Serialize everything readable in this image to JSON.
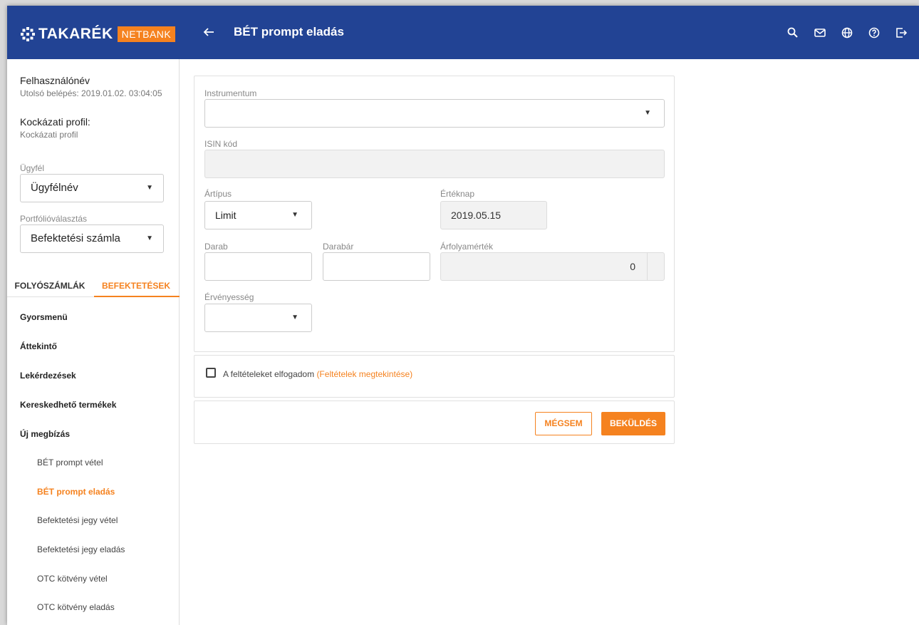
{
  "header": {
    "logo_text": "TAKARÉK",
    "logo_badge": "NETBANK",
    "title": "BÉT prompt eladás",
    "back_icon": "arrow-left-icon",
    "icons": [
      "search-icon",
      "mail-icon",
      "globe-icon",
      "help-icon",
      "logout-icon"
    ]
  },
  "sidebar": {
    "user_name": "Felhasználónév",
    "last_login": "Utolsó belépés: 2019.01.02. 03:04:05",
    "risk_title": "Kockázati profil:",
    "risk_value": "Kockázati profil",
    "client_label": "Ügyfél",
    "client_value": "Ügyfélnév",
    "portfolio_label": "Portfólióválasztás",
    "portfolio_value": "Befektetési számla",
    "tabs": [
      {
        "label": "FOLYÓSZÁMLÁK",
        "active": false
      },
      {
        "label": "BEFEKTETÉSEK",
        "active": true
      }
    ],
    "menu": [
      {
        "label": "Gyorsmenü"
      },
      {
        "label": "Áttekintő"
      },
      {
        "label": "Lekérdezések"
      },
      {
        "label": "Kereskedhető termékek"
      },
      {
        "label": "Új megbízás"
      }
    ],
    "submenu": [
      {
        "label": "BÉT prompt vétel",
        "active": false
      },
      {
        "label": "BÉT prompt eladás",
        "active": true
      },
      {
        "label": "Befektetési jegy vétel",
        "active": false
      },
      {
        "label": "Befektetési jegy eladás",
        "active": false
      },
      {
        "label": "OTC kötvény vétel",
        "active": false
      },
      {
        "label": "OTC kötvény eladás",
        "active": false
      }
    ]
  },
  "form": {
    "instrument_label": "Instrumentum",
    "instrument_value": "",
    "isin_label": "ISIN kód",
    "isin_value": "",
    "price_type_label": "Ártípus",
    "price_type_value": "Limit",
    "value_date_label": "Értéknap",
    "value_date_value": "2019.05.15",
    "quantity_label": "Darab",
    "quantity_value": "",
    "unit_price_label": "Darabár",
    "unit_price_value": "",
    "rate_value_label": "Árfolyamérték",
    "rate_value_value": "0",
    "validity_label": "Érvényesség",
    "validity_value": ""
  },
  "terms": {
    "text": "A feltételeket elfogadom",
    "link": "(Feltételek megtekintése)",
    "checked": false
  },
  "actions": {
    "cancel_label": "MÉGSEM",
    "submit_label": "BEKÜLDÉS"
  },
  "colors": {
    "header_bg": "#224394",
    "accent": "#f5821f"
  }
}
